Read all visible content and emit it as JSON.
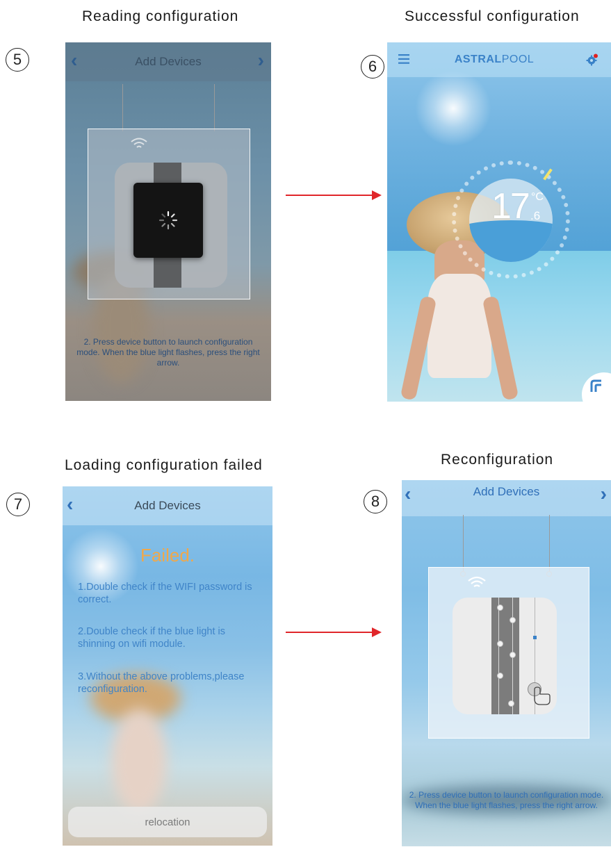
{
  "steps": [
    {
      "number": "5",
      "caption": "Reading configuration",
      "nav_title": "Add Devices",
      "back_icon": "chevron-left-icon",
      "forward_icon": "chevron-right-icon",
      "loading_icon": "spinner-icon",
      "instruction": "2. Press device button to launch configuration mode. When the blue light flashes, press the right arrow."
    },
    {
      "number": "6",
      "caption": "Successful configuration",
      "brand_bold": "ASTRAL",
      "brand_light": "POOL",
      "menu_icon": "hamburger-menu-icon",
      "settings_icon": "gear-icon",
      "temperature_whole": "17",
      "temperature_unit": "°C",
      "temperature_decimal": ".6",
      "fab_icon": "corner-arrow-icon"
    },
    {
      "number": "7",
      "caption": "Loading configuration failed",
      "nav_title": "Add Devices",
      "back_icon": "chevron-left-icon",
      "failed_title": "Failed.",
      "items": [
        "1.Double check if the WIFI password is correct.",
        "2.Double check if the blue light is shinning on wifi module.",
        "3.Without the above problems,please reconfiguration."
      ],
      "button_label": "relocation"
    },
    {
      "number": "8",
      "caption": "Reconfiguration",
      "nav_title": "Add Devices",
      "back_icon": "chevron-left-icon",
      "forward_icon": "chevron-right-icon",
      "instruction": "2. Press device button to launch configuration mode. When the blue light flashes, press the right arrow."
    }
  ],
  "colors": {
    "arrow": "#e0262a",
    "accent_blue": "#3a82c8",
    "failed_orange": "#f0a84a",
    "notification_red": "#e02020"
  }
}
